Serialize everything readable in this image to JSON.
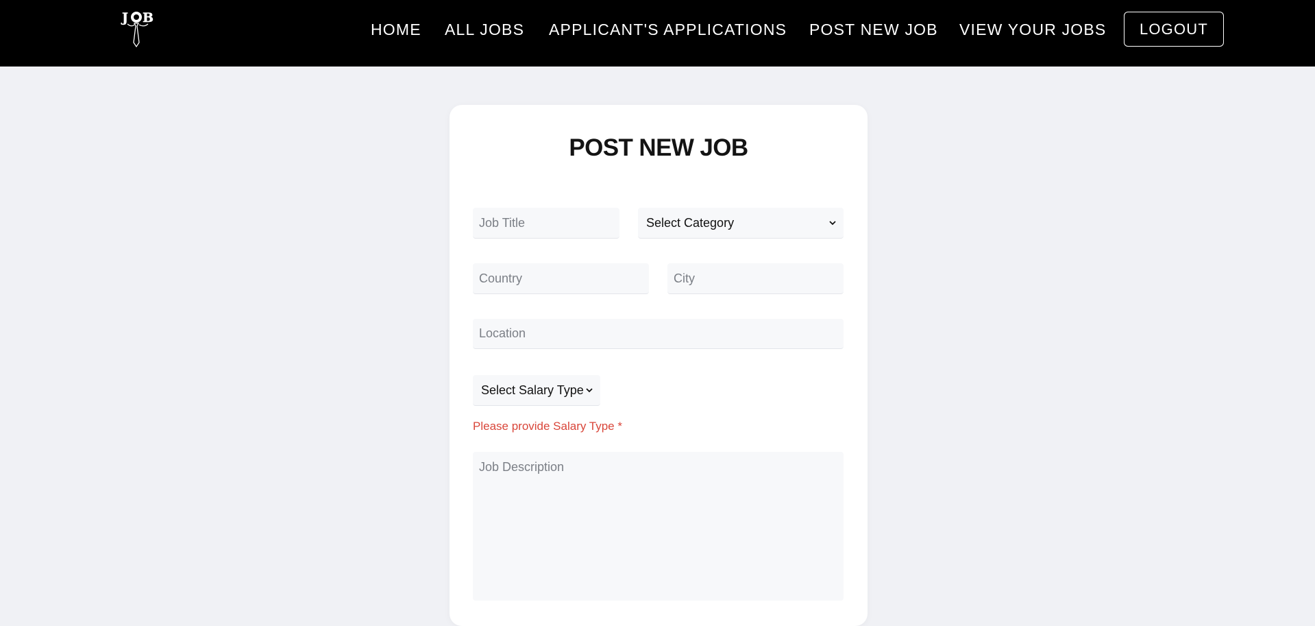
{
  "nav": {
    "links": [
      "HOME",
      "ALL JOBS",
      "APPLICANT'S APPLICATIONS",
      "POST NEW JOB",
      "VIEW YOUR JOBS"
    ],
    "logout": "LOGOUT",
    "logo_text": "JOB"
  },
  "form": {
    "title": "POST NEW JOB",
    "job_title_placeholder": "Job Title",
    "category_selected": "Select Category",
    "country_placeholder": "Country",
    "city_placeholder": "City",
    "location_placeholder": "Location",
    "salary_type_selected": "Select Salary Type",
    "salary_error": "Please provide Salary Type *",
    "description_placeholder": "Job Description"
  },
  "colors": {
    "navbar": "#000000",
    "page_background": "#f0f1f5",
    "card": "#ffffff",
    "error": "#d9463a"
  }
}
